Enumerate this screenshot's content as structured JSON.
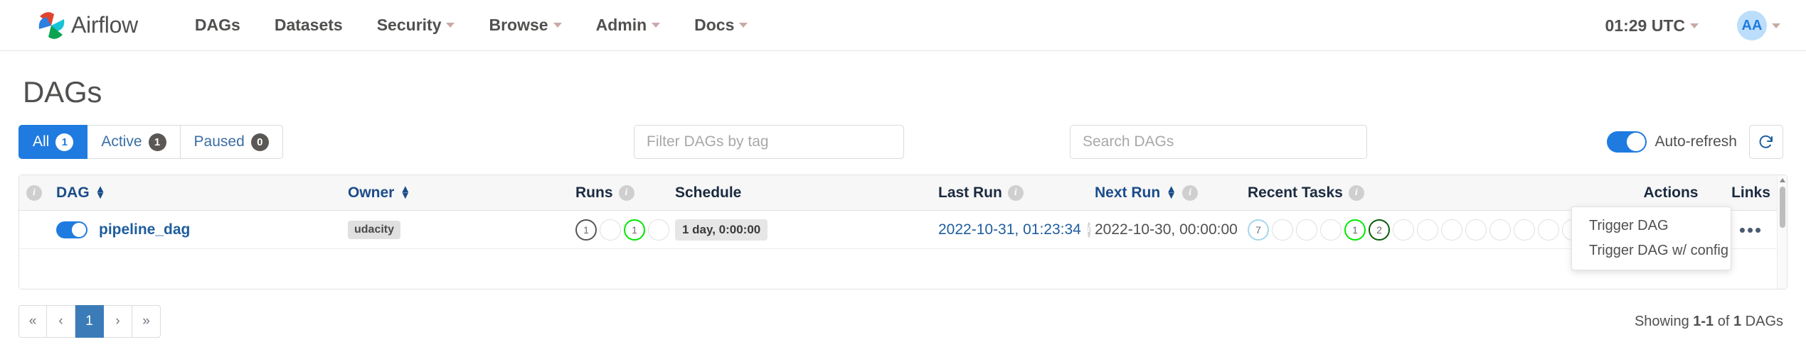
{
  "navbar": {
    "brand": "Airflow",
    "links": [
      {
        "label": "DAGs",
        "caret": false
      },
      {
        "label": "Datasets",
        "caret": false
      },
      {
        "label": "Security",
        "caret": true
      },
      {
        "label": "Browse",
        "caret": true
      },
      {
        "label": "Admin",
        "caret": true
      },
      {
        "label": "Docs",
        "caret": true
      }
    ],
    "clock": "01:29 UTC",
    "avatar_initials": "AA"
  },
  "page": {
    "title": "DAGs"
  },
  "filters": {
    "tabs": [
      {
        "label": "All",
        "count": "1",
        "active": true
      },
      {
        "label": "Active",
        "count": "1",
        "active": false
      },
      {
        "label": "Paused",
        "count": "0",
        "active": false
      }
    ],
    "tag_placeholder": "Filter DAGs by tag",
    "tag_value": "",
    "search_placeholder": "Search DAGs",
    "search_value": "",
    "autorefresh_label": "Auto-refresh",
    "autorefresh_on": true,
    "refresh_icon": "refresh-icon"
  },
  "table": {
    "headers": {
      "dag": "DAG",
      "owner": "Owner",
      "runs": "Runs",
      "schedule": "Schedule",
      "last_run": "Last Run",
      "next_run": "Next Run",
      "recent_tasks": "Recent Tasks",
      "actions": "Actions",
      "links": "Links"
    },
    "rows": [
      {
        "enabled": true,
        "dag_id": "pipeline_dag",
        "owner": "udacity",
        "runs": [
          {
            "value": "1",
            "color": "#555555",
            "filled": true
          },
          {
            "value": "",
            "color": "#e0e0e0",
            "filled": false
          },
          {
            "value": "1",
            "color": "#00e800",
            "filled": true
          },
          {
            "value": "",
            "color": "#e0e0e0",
            "filled": false
          }
        ],
        "schedule": "1 day, 0:00:00",
        "last_run": "2022-10-31, 01:23:34",
        "next_run": "2022-10-30, 00:00:00",
        "recent_tasks": [
          {
            "value": "7",
            "color": "#a6d6ec",
            "filled": true
          },
          {
            "value": "",
            "color": "#e0e0e0",
            "filled": false
          },
          {
            "value": "",
            "color": "#e0e0e0",
            "filled": false
          },
          {
            "value": "",
            "color": "#e0e0e0",
            "filled": false
          },
          {
            "value": "1",
            "color": "#00e800",
            "filled": true
          },
          {
            "value": "2",
            "color": "#0b5c0b",
            "filled": true
          },
          {
            "value": "",
            "color": "#e0e0e0",
            "filled": false
          },
          {
            "value": "",
            "color": "#e0e0e0",
            "filled": false
          },
          {
            "value": "",
            "color": "#e0e0e0",
            "filled": false
          },
          {
            "value": "",
            "color": "#e0e0e0",
            "filled": false
          },
          {
            "value": "",
            "color": "#e0e0e0",
            "filled": false
          },
          {
            "value": "",
            "color": "#e0e0e0",
            "filled": false
          },
          {
            "value": "",
            "color": "#e0e0e0",
            "filled": false
          },
          {
            "value": "",
            "color": "#e0e0e0",
            "filled": false
          }
        ],
        "trigger_icon": "play-icon",
        "delete_icon": "trash-icon",
        "links_icon": "ellipsis-icon"
      }
    ]
  },
  "dropdown": {
    "items": [
      {
        "label": "Trigger DAG"
      },
      {
        "label": "Trigger DAG w/ config"
      }
    ]
  },
  "footer": {
    "pager": [
      {
        "label": "«",
        "current": false
      },
      {
        "label": "‹",
        "current": false
      },
      {
        "label": "1",
        "current": true
      },
      {
        "label": "›",
        "current": false
      },
      {
        "label": "»",
        "current": false
      }
    ],
    "showing_prefix": "Showing",
    "showing_range": "1-1",
    "showing_mid": "of",
    "showing_total": "1",
    "showing_suffix": "DAGs"
  },
  "colors": {
    "accent": "#1f7be0",
    "link": "#1f5d9e",
    "danger": "#e8401c",
    "success": "#00e800"
  }
}
